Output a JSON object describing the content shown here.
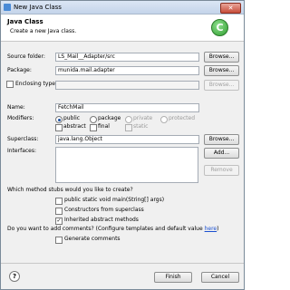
{
  "window": {
    "title": "New Java Class",
    "close_glyph": "✕"
  },
  "banner": {
    "title": "Java Class",
    "subtitle": "Create a new Java class.",
    "logo_glyph": "C"
  },
  "form": {
    "source_folder_label": "Source folder:",
    "source_folder_value": "LS_Mail__Adapter/src",
    "package_label": "Package:",
    "package_value": "munida.mail.adapter",
    "enclosing_type_label": "Enclosing type:",
    "enclosing_type_value": "",
    "name_label": "Name:",
    "name_value": "FetchMail",
    "modifiers_label": "Modifiers:",
    "mod_public": "public",
    "mod_package": "package",
    "mod_private": "private",
    "mod_protected": "protected",
    "mod_abstract": "abstract",
    "mod_final": "final",
    "mod_static": "static",
    "superclass_label": "Superclass:",
    "superclass_value": "java.lang.Object",
    "interfaces_label": "Interfaces:",
    "browse": "Browse...",
    "add": "Add...",
    "remove": "Remove"
  },
  "stubs": {
    "question": "Which method stubs would you like to create?",
    "main": "public static void main(String[] args)",
    "constructors": "Constructors from superclass",
    "inherited": "Inherited abstract methods",
    "check_glyph": "✓"
  },
  "comments": {
    "question": "Do you want to add comments? (Configure templates and default value here)",
    "link_text": "here",
    "generate": "Generate comments"
  },
  "footer": {
    "help_glyph": "?",
    "finish": "Finish",
    "cancel": "Cancel"
  }
}
